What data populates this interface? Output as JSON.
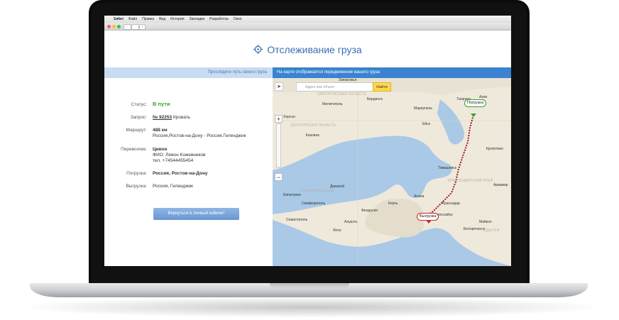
{
  "menubar": {
    "items": [
      "Safari",
      "Файл",
      "Правка",
      "Вид",
      "История",
      "Закладки",
      "Разработка",
      "Окно"
    ]
  },
  "toolbar": {
    "reader": "≡",
    "tab": "⊟"
  },
  "page": {
    "title": "Отслеживание груза",
    "title_icon": "crosshair-icon"
  },
  "bars": {
    "left": "Проследите путь своего груза",
    "right": "На карте отображается передвижение вашего груза"
  },
  "info": {
    "status_label": "Статус:",
    "status_value": "В пути",
    "request_label": "Запрос:",
    "request_number": "№ 92253",
    "request_item": " Кровать",
    "route_label": "Маршрут:",
    "route_km": "488 км",
    "route_path": "Россия,Ростов-на-Дону - Россия,Геленджик",
    "carrier_label": "Перевозчик:",
    "carrier_name": "Цивон",
    "carrier_person": "ФИО: Левон Кожевников",
    "carrier_phone": "тел. +74544455454",
    "loading_label": "Погрузка:",
    "loading_value": "Россия, Ростов-на-Дону",
    "unloading_label": "Выгрузка:",
    "unloading_value": "Россия, Геленджик",
    "back_button": "Вернуться в личный кабинет"
  },
  "map": {
    "search_placeholder": "Адрес или объект",
    "find_button": "Найти",
    "top_label": "Запорожье",
    "pin_loading": "Погрузка",
    "pin_unloading": "Выгрузка",
    "zoom_in": "+",
    "zoom_out": "−",
    "nav_icon": "➤",
    "towns": [
      "Мелитополь",
      "Бердянск",
      "Мариуполь",
      "Таганрог",
      "Ейск",
      "Херсон",
      "Джанкой",
      "Симферополь",
      "Севастополь",
      "Керчь",
      "Феодосия",
      "Анапа",
      "Новороссийск",
      "Краснодар",
      "Майкоп",
      "Кропоткин",
      "Тимашевск",
      "Армавир",
      "Белореченск",
      "Каховка",
      "Ялта",
      "Алушта",
      "Евпатория",
      "Азов"
    ],
    "regions": [
      "ХЕРСОНСКАЯ ОБЛАСТЬ",
      "Республика Крым",
      "КРАСНОДАРСКИЙ КРАЙ",
      "АДЫГЕЯ",
      "ЗАПОРОЖСКАЯ ОБЛАСТЬ"
    ],
    "colors": {
      "land": "#efe9dc",
      "sea": "#a9c9e6",
      "route": "#9b1b1b",
      "pin_loading": "#3aa02a",
      "pin_unloading": "#cc2222"
    }
  }
}
